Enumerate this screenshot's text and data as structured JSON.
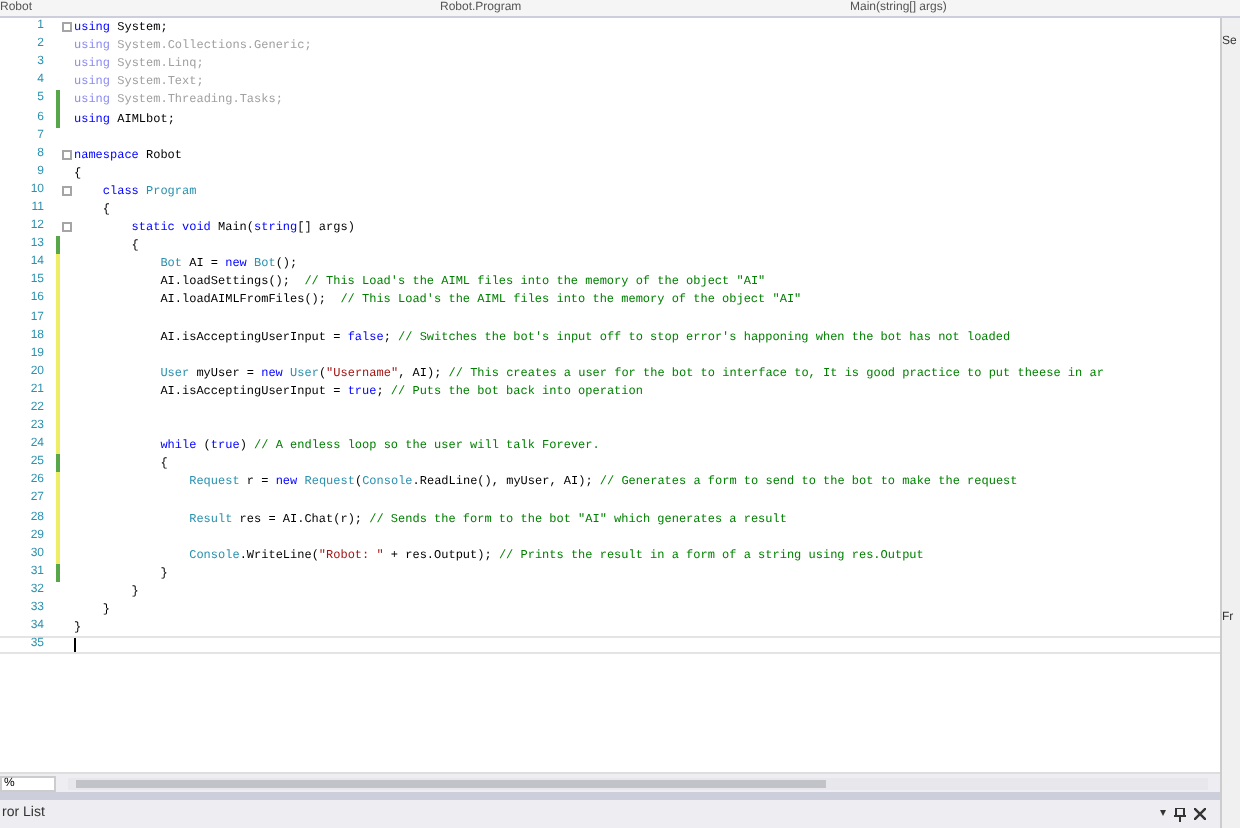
{
  "tabs": [
    {
      "label": "Robot"
    },
    {
      "label": "Robot.Program"
    },
    {
      "label": "Main(string[] args)"
    }
  ],
  "lines": [
    {
      "number": "1",
      "collapsible": true,
      "modified": false,
      "tokens": [
        {
          "kind": "kw",
          "text": "using"
        },
        {
          "kind": "pl",
          "text": " System;"
        }
      ]
    },
    {
      "number": "2",
      "modified": false,
      "tokens": [
        {
          "kind": "fkw",
          "text": "using"
        },
        {
          "kind": "faded",
          "text": " System.Collections.Generic;"
        }
      ]
    },
    {
      "number": "3",
      "modified": false,
      "tokens": [
        {
          "kind": "fkw",
          "text": "using"
        },
        {
          "kind": "faded",
          "text": " System.Linq;"
        }
      ]
    },
    {
      "number": "4",
      "modified": false,
      "tokens": [
        {
          "kind": "fkw",
          "text": "using"
        },
        {
          "kind": "faded",
          "text": " System.Text;"
        }
      ]
    },
    {
      "number": "5",
      "modified": true,
      "saved": true,
      "tokens": [
        {
          "kind": "fkw",
          "text": "using"
        },
        {
          "kind": "faded",
          "text": " System.Threading.Tasks;"
        }
      ]
    },
    {
      "number": "6",
      "modified": true,
      "saved": true,
      "tokens": [
        {
          "kind": "kw",
          "text": "using"
        },
        {
          "kind": "pl",
          "text": " AIMLbot;"
        }
      ]
    },
    {
      "number": "7",
      "modified": false
    },
    {
      "number": "8",
      "collapsible": true,
      "modified": false,
      "tokens": [
        {
          "kind": "kw",
          "text": "namespace"
        },
        {
          "kind": "pl",
          "text": " Robot"
        }
      ]
    },
    {
      "number": "9",
      "modified": false,
      "tokens": [
        {
          "kind": "pl",
          "text": "{"
        }
      ]
    },
    {
      "number": "10",
      "collapsible": true,
      "modified": false,
      "tokens": [
        {
          "kind": "kw",
          "text": "    class"
        },
        {
          "kind": "type",
          "text": " Program"
        }
      ]
    },
    {
      "number": "11",
      "modified": false,
      "tokens": [
        {
          "kind": "pl",
          "text": "    {"
        }
      ]
    },
    {
      "number": "12",
      "collapsible": true,
      "modified": false,
      "tokens": [
        {
          "kind": "kw",
          "text": "        static void"
        },
        {
          "kind": "pl",
          "text": " Main("
        },
        {
          "kind": "kw",
          "text": "string"
        },
        {
          "kind": "pl",
          "text": "[] args)"
        }
      ]
    },
    {
      "number": "13",
      "modified": true,
      "saved": true,
      "tokens": [
        {
          "kind": "pl",
          "text": "        {"
        }
      ]
    },
    {
      "number": "14",
      "modified": true,
      "saved": false,
      "tokens": [
        {
          "kind": "type",
          "text": "            Bot"
        },
        {
          "kind": "pl",
          "text": " AI = "
        },
        {
          "kind": "kw",
          "text": "new"
        },
        {
          "kind": "type",
          "text": " Bot"
        },
        {
          "kind": "pl",
          "text": "();"
        }
      ]
    },
    {
      "number": "15",
      "modified": true,
      "saved": false,
      "tokens": [
        {
          "kind": "pl",
          "text": "            AI.loadSettings();  "
        },
        {
          "kind": "cm",
          "text": "// This Load's the AIML files into the memory of the object \"AI\""
        }
      ]
    },
    {
      "number": "16",
      "modified": true,
      "saved": false,
      "tokens": [
        {
          "kind": "pl",
          "text": "            AI.loadAIMLFromFiles();  "
        },
        {
          "kind": "cm",
          "text": "// This Load's the AIML files into the memory of the object \"AI\""
        }
      ]
    },
    {
      "number": "17",
      "modified": true,
      "saved": false
    },
    {
      "number": "18",
      "modified": true,
      "saved": false,
      "tokens": [
        {
          "kind": "pl",
          "text": "            AI.isAcceptingUserInput = "
        },
        {
          "kind": "kw",
          "text": "false"
        },
        {
          "kind": "pl",
          "text": "; "
        },
        {
          "kind": "cm",
          "text": "// Switches the bot's input off to stop error's happoning when the bot has not loaded"
        }
      ]
    },
    {
      "number": "19",
      "modified": true,
      "saved": false
    },
    {
      "number": "20",
      "modified": true,
      "saved": false,
      "tokens": [
        {
          "kind": "type",
          "text": "            User"
        },
        {
          "kind": "pl",
          "text": " myUser = "
        },
        {
          "kind": "kw",
          "text": "new"
        },
        {
          "kind": "type",
          "text": " User"
        },
        {
          "kind": "pl",
          "text": "("
        },
        {
          "kind": "str",
          "text": "\"Username\""
        },
        {
          "kind": "pl",
          "text": ", AI); "
        },
        {
          "kind": "cm",
          "text": "// This creates a user for the bot to interface to, It is good practice to put theese in ar"
        }
      ]
    },
    {
      "number": "21",
      "modified": true,
      "saved": false,
      "tokens": [
        {
          "kind": "pl",
          "text": "            AI.isAcceptingUserInput = "
        },
        {
          "kind": "kw",
          "text": "true"
        },
        {
          "kind": "pl",
          "text": "; "
        },
        {
          "kind": "cm",
          "text": "// Puts the bot back into operation"
        }
      ]
    },
    {
      "number": "22",
      "modified": true,
      "saved": false
    },
    {
      "number": "23",
      "modified": true,
      "saved": false
    },
    {
      "number": "24",
      "modified": true,
      "saved": false,
      "tokens": [
        {
          "kind": "kw",
          "text": "            while"
        },
        {
          "kind": "pl",
          "text": " ("
        },
        {
          "kind": "kw",
          "text": "true"
        },
        {
          "kind": "pl",
          "text": ") "
        },
        {
          "kind": "cm",
          "text": "// A endless loop so the user will talk Forever."
        }
      ]
    },
    {
      "number": "25",
      "modified": true,
      "saved": true,
      "tokens": [
        {
          "kind": "pl",
          "text": "            {"
        }
      ]
    },
    {
      "number": "26",
      "modified": true,
      "saved": false,
      "tokens": [
        {
          "kind": "type",
          "text": "                Request"
        },
        {
          "kind": "pl",
          "text": " r = "
        },
        {
          "kind": "kw",
          "text": "new"
        },
        {
          "kind": "type",
          "text": " Request"
        },
        {
          "kind": "pl",
          "text": "("
        },
        {
          "kind": "type",
          "text": "Console"
        },
        {
          "kind": "pl",
          "text": ".ReadLine(), myUser, AI); "
        },
        {
          "kind": "cm",
          "text": "// Generates a form to send to the bot to make the request"
        }
      ]
    },
    {
      "number": "27",
      "modified": true,
      "saved": false
    },
    {
      "number": "28",
      "modified": true,
      "saved": false,
      "tokens": [
        {
          "kind": "type",
          "text": "                Result"
        },
        {
          "kind": "pl",
          "text": " res = AI.Chat(r); "
        },
        {
          "kind": "cm",
          "text": "// Sends the form to the bot \"AI\" which generates a result"
        }
      ]
    },
    {
      "number": "29",
      "modified": true,
      "saved": false
    },
    {
      "number": "30",
      "modified": true,
      "saved": false,
      "tokens": [
        {
          "kind": "type",
          "text": "                Console"
        },
        {
          "kind": "pl",
          "text": ".WriteLine("
        },
        {
          "kind": "str",
          "text": "\"Robot: \""
        },
        {
          "kind": "pl",
          "text": " + res.Output); "
        },
        {
          "kind": "cm",
          "text": "// Prints the result in a form of a string using res.Output"
        }
      ]
    },
    {
      "number": "31",
      "modified": true,
      "saved": true,
      "tokens": [
        {
          "kind": "pl",
          "text": "            }"
        }
      ]
    },
    {
      "number": "32",
      "modified": false,
      "tokens": [
        {
          "kind": "pl",
          "text": "        }"
        }
      ]
    },
    {
      "number": "33",
      "modified": false,
      "tokens": [
        {
          "kind": "pl",
          "text": "    }"
        }
      ]
    },
    {
      "number": "34",
      "modified": false,
      "tokens": [
        {
          "kind": "pl",
          "text": "}"
        }
      ]
    },
    {
      "number": "35",
      "modified": false,
      "current": true
    }
  ],
  "zoom": {
    "value": "%"
  },
  "bottom_panel": {
    "title": "ror List",
    "menu_glyph": "▾"
  },
  "side_panel": {
    "labels": [
      "Se",
      "Fr"
    ]
  }
}
